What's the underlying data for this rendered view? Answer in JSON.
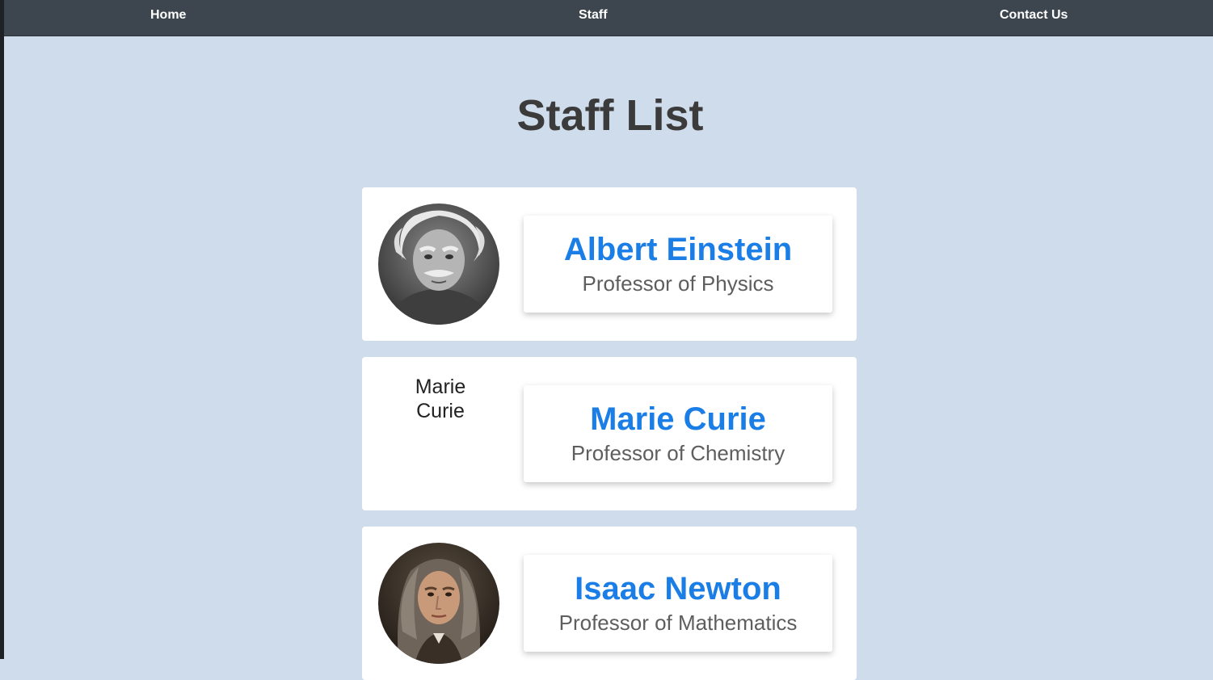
{
  "nav": {
    "home": "Home",
    "staff": "Staff",
    "contact": "Contact Us"
  },
  "page": {
    "title": "Staff List"
  },
  "staff": [
    {
      "name": "Albert Einstein",
      "role": "Professor of Physics",
      "photo_alt": ""
    },
    {
      "name": "Marie Curie",
      "role": "Professor of Chemistry",
      "photo_alt": "Marie Curie"
    },
    {
      "name": "Isaac Newton",
      "role": "Professor of Mathematics",
      "photo_alt": ""
    }
  ],
  "colors": {
    "background": "#cfdcec",
    "navbar": "#3d464e",
    "name_link": "#1a7ee6",
    "role_text": "#5e5e5e",
    "title_text": "#3b3b3b"
  }
}
